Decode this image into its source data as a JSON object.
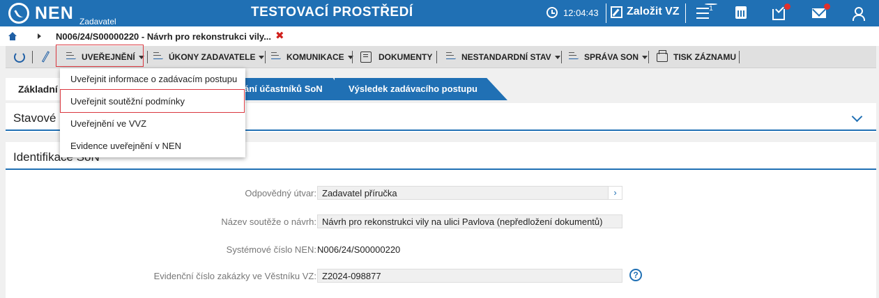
{
  "header": {
    "logo_text": "NEN",
    "logo_sub": "Zadavatel",
    "env_title": "TESTOVACÍ PROSTŘEDÍ",
    "clock": "12:04:43",
    "create_label": "Založit VZ",
    "menu_badge": "1"
  },
  "breadcrumb": {
    "title": "N006/24/S00000220 - Návrh pro rekonstrukci vily...",
    "close_glyph": "✖"
  },
  "toolbar": {
    "publish": "UVEŘEJNĚNÍ",
    "actions": "ÚKONY ZADAVATELE",
    "communication": "KOMUNIKACE",
    "documents": "DOKUMENTY",
    "nonstandard": "NESTANDARDNÍ STAV",
    "son_admin": "SPRÁVA SON",
    "print": "TISK ZÁZNAMU"
  },
  "dropdown": {
    "items": [
      "Uveřejnit informace o zadávacím postupu",
      "Uveřejnit soutěžní podmínky",
      "Uveřejnění ve VVZ",
      "Evidence uveřejnění v NEN"
    ]
  },
  "tabs": {
    "active": "Základní",
    "tab2": "ání účastníků SoN",
    "tab3": "Výsledek zadávacího postupu"
  },
  "panels": {
    "status_title": "Stavové",
    "ident_title": "Identifikace SoN"
  },
  "form": {
    "unit_label": "Odpovědný útvar:",
    "unit_value": "Zadavatel příručka",
    "name_label": "Název soutěže o návrh:",
    "name_value": "Návrh pro rekonstrukci vily na ulici Pavlova (nepředložení dokumentů)",
    "sysnum_label": "Systémové číslo NEN:",
    "sysnum_value": "N006/24/S00000220",
    "evnum_label": "Evidenční číslo zakázky ve Věstníku VZ:",
    "evnum_value": "Z2024-098877",
    "picker_glyph": "›",
    "help_glyph": "?"
  },
  "colors": {
    "brand_blue": "#2070b4",
    "highlight_red": "#d9363e",
    "badge_red": "#e0302c"
  },
  "icons": [
    "home-icon",
    "refresh-icon",
    "pencil-icon",
    "clock-icon",
    "edit-icon",
    "menu-icon",
    "calculator-icon",
    "inbox-icon",
    "mail-icon",
    "user-icon",
    "document-icon",
    "print-icon",
    "chevron-down-icon",
    "help-icon"
  ]
}
